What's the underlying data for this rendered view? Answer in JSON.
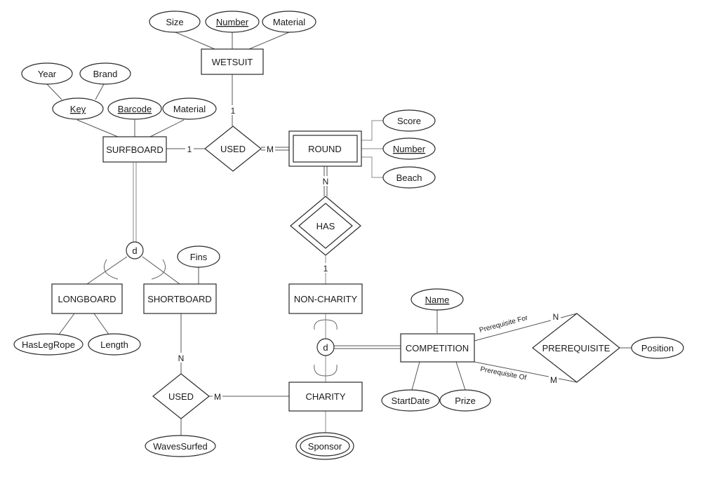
{
  "entities": {
    "wetsuit": "WETSUIT",
    "surfboard": "SURFBOARD",
    "round": "ROUND",
    "longboard": "LONGBOARD",
    "shortboard": "SHORTBOARD",
    "non_charity": "NON-CHARITY",
    "charity": "CHARITY",
    "competition": "COMPETITION"
  },
  "relationships": {
    "used_top": "USED",
    "has": "HAS",
    "used_bottom": "USED",
    "prerequisite": "PREREQUISITE"
  },
  "attributes": {
    "wetsuit_size": "Size",
    "wetsuit_number": "Number",
    "wetsuit_material": "Material",
    "surfboard_year": "Year",
    "surfboard_brand": "Brand",
    "surfboard_key": "Key",
    "surfboard_barcode": "Barcode",
    "surfboard_material": "Material",
    "round_score": "Score",
    "round_number": "Number",
    "round_beach": "Beach",
    "shortboard_fins": "Fins",
    "longboard_hasleg": "HasLegRope",
    "longboard_length": "Length",
    "competition_name": "Name",
    "competition_startdate": "StartDate",
    "competition_prize": "Prize",
    "prerequisite_position": "Position",
    "used_wavessurfed": "WavesSurfed",
    "charity_sponsor": "Sponsor"
  },
  "specializations": {
    "board_disjoint": "d",
    "competition_disjoint": "d"
  },
  "cardinalities": {
    "used_wetsuit": "1",
    "used_surfboard": "1",
    "used_round": "M",
    "has_round": "N",
    "has_noncharity": "1",
    "used_shortboard": "N",
    "used_charity": "M",
    "prereq_for": "N",
    "prereq_of": "M"
  },
  "role_labels": {
    "prereq_for": "Prerequisite For",
    "prereq_of": "Prerequisite Of"
  }
}
